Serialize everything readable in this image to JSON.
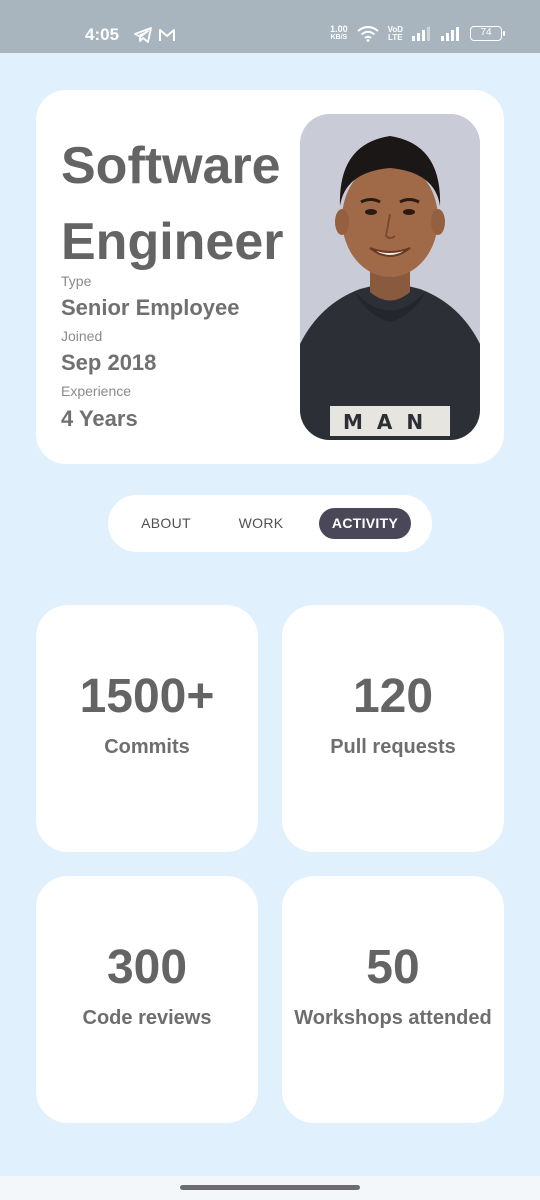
{
  "status_bar": {
    "time": "4:05",
    "net_speed_value": "1.00",
    "net_speed_unit": "KB/S",
    "volte_top": "VoD",
    "volte_bottom": "LTE",
    "battery": "74"
  },
  "profile": {
    "title": "Software Engineer",
    "type_label": "Type",
    "type_value": "Senior Employee",
    "joined_label": "Joined",
    "joined_value": "Sep 2018",
    "experience_label": "Experience",
    "experience_value": "4 Years",
    "shirt_text": "MAN"
  },
  "tabs": [
    {
      "label": "ABOUT",
      "active": false
    },
    {
      "label": "WORK",
      "active": false
    },
    {
      "label": "ACTIVITY",
      "active": true
    }
  ],
  "stats": [
    {
      "value": "1500+",
      "label": "Commits"
    },
    {
      "value": "120",
      "label": "Pull requests"
    },
    {
      "value": "300",
      "label": "Code reviews"
    },
    {
      "value": "50",
      "label": "Workshops attended"
    }
  ]
}
